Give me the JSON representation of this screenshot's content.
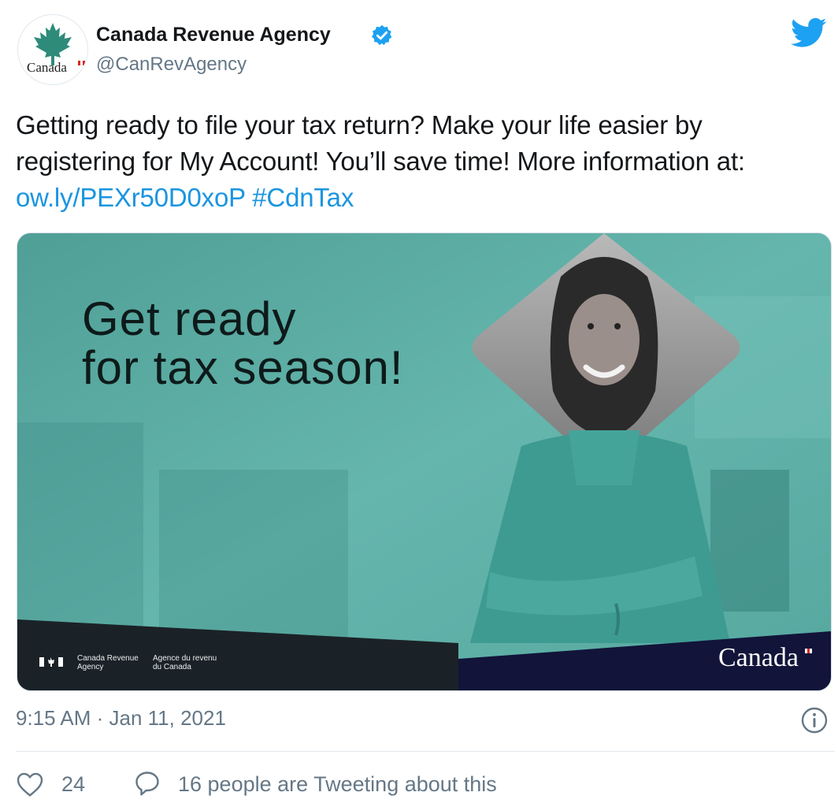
{
  "account": {
    "display_name": "Canada Revenue Agency",
    "handle": "@CanRevAgency",
    "avatar_wordmark": "Canada",
    "verified": true,
    "verified_icon": "verified-badge-icon",
    "platform_icon": "twitter-bird-icon"
  },
  "tweet": {
    "text_before_link": "Getting ready to file your tax return? Make your life easier by registering for My Account! You’ll save time! More information at: ",
    "link": "ow.ly/PEXr50D0xoP",
    "hashtag": "#CdnTax"
  },
  "media": {
    "headline_line1": "Get ready",
    "headline_line2": "for tax season!",
    "agency_en_line1": "Canada Revenue",
    "agency_en_line2": "Agency",
    "agency_fr_line1": "Agence du revenu",
    "agency_fr_line2": "du Canada",
    "wordmark": "Canada"
  },
  "meta": {
    "timestamp": "9:15 AM · Jan 11, 2021",
    "info_icon": "info-icon"
  },
  "engagement": {
    "like_count": "24",
    "like_icon": "heart-icon",
    "reply_icon": "speech-bubble-icon",
    "conversation_text": "16 people are Tweeting about this"
  },
  "colors": {
    "link": "#1b95e0",
    "verified": "#1da1f2",
    "muted_text": "#657786",
    "media_teal": "#5fb0a8",
    "canada_red": "#d52b1e"
  }
}
